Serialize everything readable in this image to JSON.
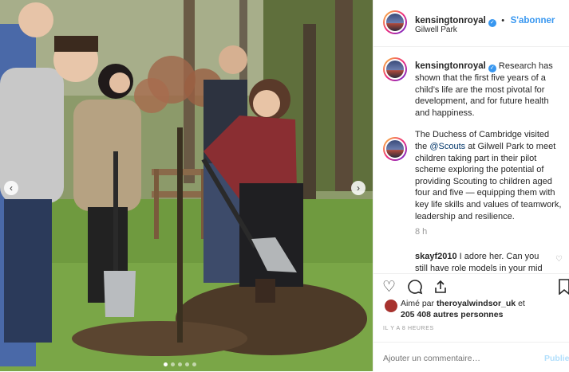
{
  "post": {
    "username": "kensingtonroyal",
    "verified_icon": "verified-badge-icon",
    "separator": "•",
    "follow_label": "S'abonner",
    "location": "Gilwell Park"
  },
  "caption": {
    "username": "kensingtonroyal",
    "paragraph1": "Research has shown that the first five years of a child’s life are the most pivotal for development, and for future health and happiness.",
    "paragraph2_before": "The Duchess of Cambridge visited the ",
    "paragraph2_mention": "@Scouts",
    "paragraph2_after": " at Gilwell Park to meet children taking part in their pilot scheme exploring the potential of providing Scouting to children aged four and five — equipping them with key life skills and values of teamwork, leadership and resilience.",
    "time": "8 h"
  },
  "comment": {
    "username": "skayf2010",
    "text": "I adore her. Can you still have role models in your mid"
  },
  "actions": {
    "like_icon": "heart-icon",
    "comment_icon": "comment-bubble-icon",
    "share_icon": "share-icon",
    "save_icon": "bookmark-icon"
  },
  "likes": {
    "prefix": "Aimé par",
    "user": "theroyalwindsor_uk",
    "suffix": "et",
    "others": "205 408 autres personnes"
  },
  "timestamp": "IL Y A 8 HEURES",
  "add_comment": {
    "placeholder": "Ajouter un commentaire…",
    "publish_label": "Publier"
  },
  "carousel": {
    "prev_icon": "chevron-left-icon",
    "next_icon": "chevron-right-icon",
    "slide_count": 5,
    "active_slide": 1
  },
  "colors": {
    "accent": "#3897f0",
    "text": "#262626",
    "muted": "#999999"
  }
}
